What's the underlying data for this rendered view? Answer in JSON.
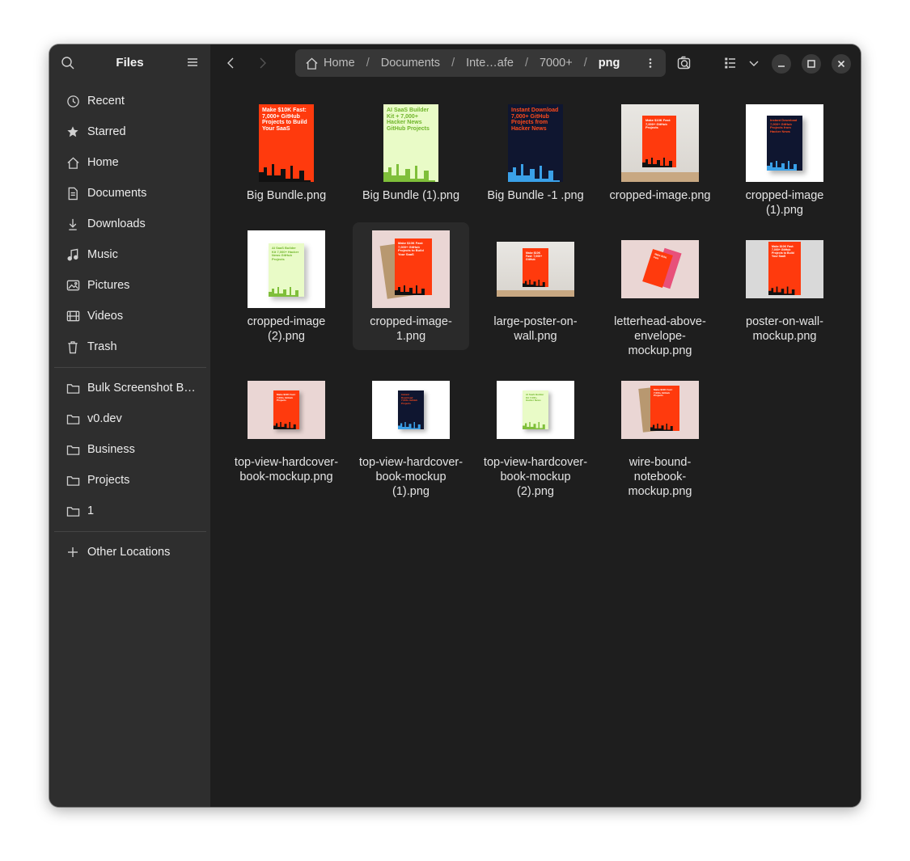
{
  "app": {
    "title": "Files"
  },
  "sidebar": {
    "items": [
      {
        "label": "Recent",
        "icon": "recent-icon"
      },
      {
        "label": "Starred",
        "icon": "star-icon"
      },
      {
        "label": "Home",
        "icon": "home-icon"
      },
      {
        "label": "Documents",
        "icon": "document-icon"
      },
      {
        "label": "Downloads",
        "icon": "download-icon"
      },
      {
        "label": "Music",
        "icon": "music-icon"
      },
      {
        "label": "Pictures",
        "icon": "pictures-icon"
      },
      {
        "label": "Videos",
        "icon": "videos-icon"
      },
      {
        "label": "Trash",
        "icon": "trash-icon"
      }
    ],
    "bookmarks": [
      {
        "label": "Bulk Screenshot B…",
        "icon": "folder-icon"
      },
      {
        "label": "v0.dev",
        "icon": "folder-icon"
      },
      {
        "label": "Business",
        "icon": "folder-icon"
      },
      {
        "label": "Projects",
        "icon": "folder-icon"
      },
      {
        "label": "1",
        "icon": "folder-icon"
      }
    ],
    "other": {
      "label": "Other Locations",
      "icon": "plus-icon"
    }
  },
  "header": {
    "path": [
      "Home",
      "Documents",
      "Inte…afe",
      "7000+",
      "png"
    ],
    "separator": "/"
  },
  "files": [
    {
      "name": "Big Bundle.png",
      "thumb_text": "Make $10K Fast: 7,000+ GitHub Projects to Build Your SaaS"
    },
    {
      "name": "Big Bundle (1).png",
      "thumb_text": "AI SaaS Builder Kit + 7,000+ Hacker News GitHub Projects"
    },
    {
      "name": "Big Bundle -1 .png",
      "thumb_text": "Instant Download 7,000+ GitHub Projects from Hacker News"
    },
    {
      "name": "cropped-image.png",
      "thumb_text": "Make $10K Fast: 7,000+ GitHub Projects"
    },
    {
      "name": "cropped-image (1).png",
      "thumb_text": "Instant Download 7,000+ GitHub Projects from Hacker News"
    },
    {
      "name": "cropped-image (2).png",
      "thumb_text": "AI SaaS Builder Kit 7,000+ Hacker News GitHub Projects"
    },
    {
      "name": "cropped-image-1.png",
      "thumb_text": "Make $10K Fast: 7,000+ GitHub Projects to Build Your SaaS"
    },
    {
      "name": "large-poster-on-wall.png",
      "thumb_text": "Make $10K Fast: 7,000+ GitHub"
    },
    {
      "name": "letterhead-above-envelope-mockup.png",
      "thumb_text": "Make $10K Fast"
    },
    {
      "name": "poster-on-wall-mockup.png",
      "thumb_text": "Make $10K Fast: 7,000+ GitHub Projects to Build Your SaaS"
    },
    {
      "name": "top-view-hardcover-book-mockup.png",
      "thumb_text": "Make $10K Fast: 7,000+ GitHub Projects"
    },
    {
      "name": "top-view-hardcover-book-mockup (1).png",
      "thumb_text": "Instant Download 7,000+ GitHub Projects"
    },
    {
      "name": "top-view-hardcover-book-mockup (2).png",
      "thumb_text": "AI SaaS Builder Kit 7,000+ Hacker News"
    },
    {
      "name": "wire-bound-notebook-mockup.png",
      "thumb_text": "Make $10K Fast: 7,000+ GitHub Projects"
    }
  ],
  "colors": {
    "sidebar_bg": "#2e2e2e",
    "main_bg": "#1e1e1e",
    "pathbar_bg": "#373737",
    "accent_red": "#ff3a0d",
    "accent_green": "#7fbf3a",
    "accent_navy": "#0f1630"
  }
}
